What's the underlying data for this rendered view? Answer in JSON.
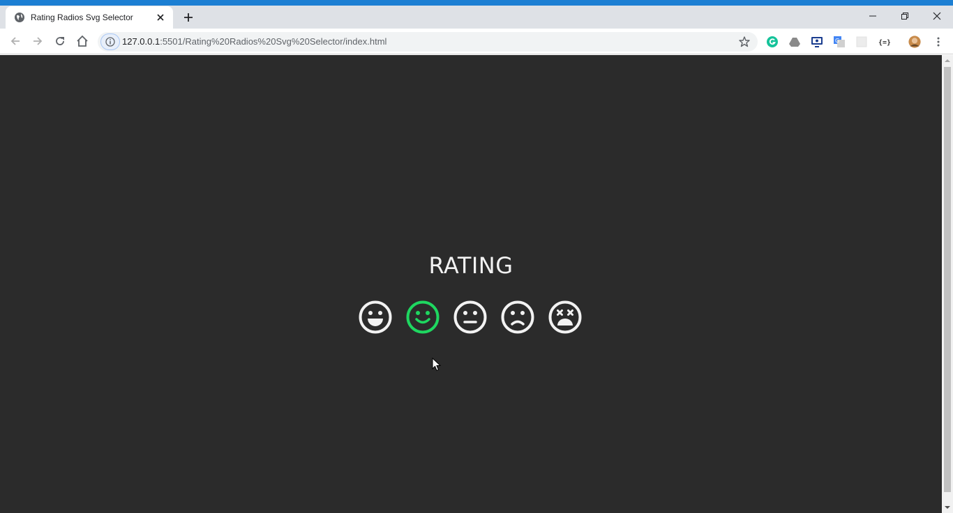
{
  "browser": {
    "tab_title": "Rating Radios Svg Selector",
    "url_host": "127.0.0.1",
    "url_rest": ":5501/Rating%20Radios%20Svg%20Selector/index.html",
    "extensions": [
      "grammarly-icon",
      "drive-icon",
      "screen-icon",
      "translate-icon",
      "blank-extension-icon",
      "json-icon",
      "profile-avatar"
    ]
  },
  "page": {
    "heading": "RATING",
    "faces": [
      {
        "name": "very-happy",
        "selected": false
      },
      {
        "name": "happy",
        "selected": true
      },
      {
        "name": "neutral",
        "selected": false
      },
      {
        "name": "sad",
        "selected": false
      },
      {
        "name": "very-sad",
        "selected": false
      }
    ],
    "colors": {
      "background": "#2b2b2b",
      "face": "#f2f2f2",
      "selected": "#1ed760"
    }
  }
}
